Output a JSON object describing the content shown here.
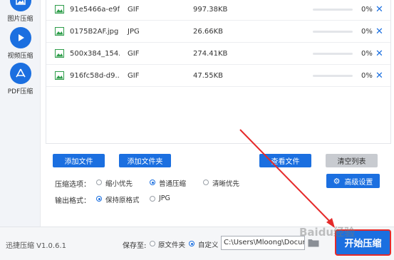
{
  "sidebar": {
    "items": [
      {
        "label": "图片压缩",
        "icon": "image-icon"
      },
      {
        "label": "视频压缩",
        "icon": "play-icon"
      },
      {
        "label": "PDF压缩",
        "icon": "pdf-icon"
      }
    ]
  },
  "files": [
    {
      "name": "91e5466a-e9f...",
      "type": "GIF",
      "size": "997.38KB",
      "progress": 0,
      "percent": "0%"
    },
    {
      "name": "0175B2AF.jpg",
      "type": "JPG",
      "size": "26.66KB",
      "progress": 0,
      "percent": "0%"
    },
    {
      "name": "500x384_154...",
      "type": "GIF",
      "size": "274.41KB",
      "progress": 0,
      "percent": "0%"
    },
    {
      "name": "916fc58d-d9...",
      "type": "GIF",
      "size": "47.55KB",
      "progress": 0,
      "percent": "0%"
    }
  ],
  "actions": {
    "add_file": "添加文件",
    "add_folder": "添加文件夹",
    "view_file": "查看文件",
    "clear_list": "清空列表",
    "advanced": "高级设置"
  },
  "options": {
    "compress_label": "压缩选项：",
    "compress_options": [
      "缩小优先",
      "普通压缩",
      "清晰优先"
    ],
    "compress_selected": "普通压缩",
    "format_label": "输出格式：",
    "format_options": [
      "保持原格式",
      "JPG"
    ],
    "format_selected": "保持原格式"
  },
  "footer": {
    "version": "迅捷压缩 V1.0.6.1",
    "save_label": "保存至:",
    "save_options": [
      "原文件夹",
      "自定义"
    ],
    "save_selected": "自定义",
    "path": "C:\\Users\\Mloong\\Docume",
    "start": "开始压缩",
    "watermark": "Baidu经验"
  },
  "colors": {
    "accent": "#1b6fe0",
    "highlight": "#e52a2a"
  }
}
